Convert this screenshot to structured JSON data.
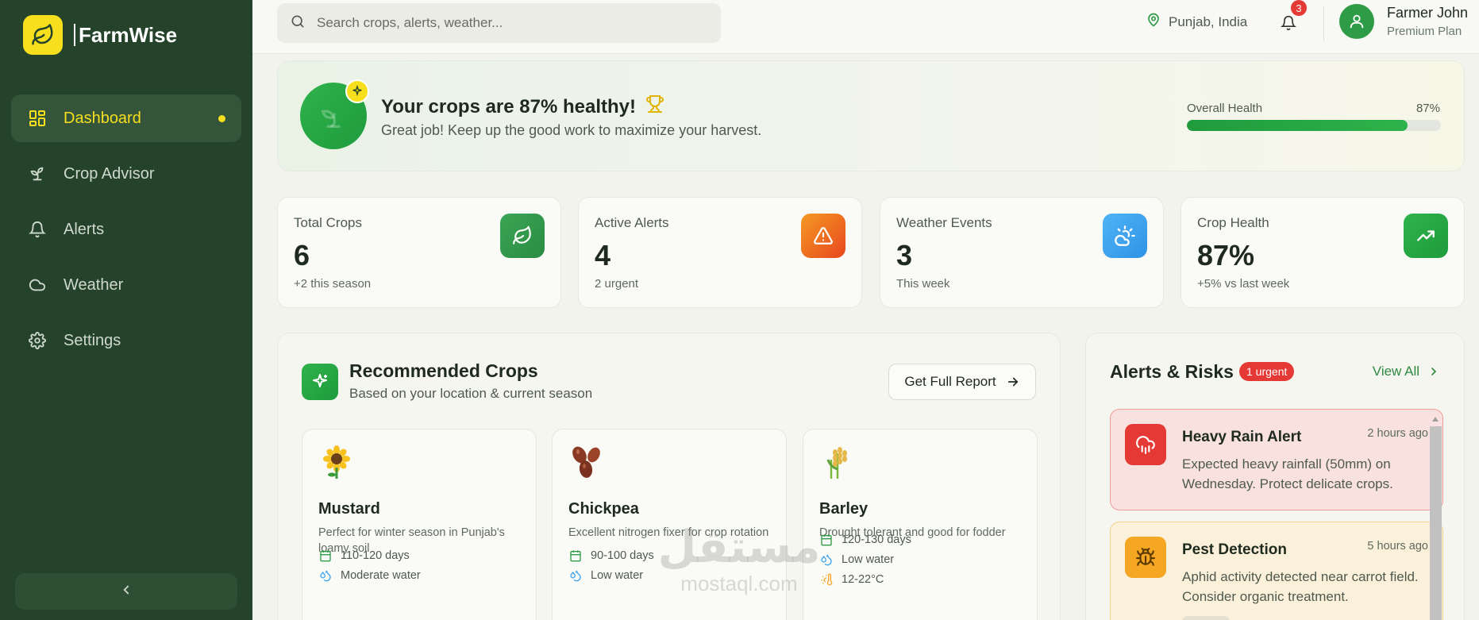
{
  "brand": {
    "name": "FarmWise"
  },
  "sidebar": {
    "items": [
      {
        "label": "Dashboard",
        "icon": "grid-icon",
        "active": true
      },
      {
        "label": "Crop Advisor",
        "icon": "sprout-icon",
        "active": false
      },
      {
        "label": "Alerts",
        "icon": "bell-icon",
        "active": false
      },
      {
        "label": "Weather",
        "icon": "cloud-icon",
        "active": false
      },
      {
        "label": "Settings",
        "icon": "gear-icon",
        "active": false
      }
    ]
  },
  "topbar": {
    "search_placeholder": "Search crops, alerts, weather...",
    "location": "Punjab, India",
    "notification_count": "3",
    "user_name": "Farmer John",
    "user_plan": "Premium Plan"
  },
  "banner": {
    "title": "Your crops are 87% healthy!",
    "subtitle": "Great job! Keep up the good work to maximize your harvest.",
    "health_label": "Overall Health",
    "health_value": "87%",
    "health_fraction": 0.87
  },
  "stats": [
    {
      "label": "Total Crops",
      "value": "6",
      "sub": "+2 this season",
      "icon": "leaf-icon",
      "color": "#2e9b47"
    },
    {
      "label": "Active Alerts",
      "value": "4",
      "sub": "2 urgent",
      "icon": "warning-icon",
      "color": "#f06a1e"
    },
    {
      "label": "Weather Events",
      "value": "3",
      "sub": "This week",
      "icon": "sun-cloud-icon",
      "color": "#3ba3f0"
    },
    {
      "label": "Crop Health",
      "value": "87%",
      "sub": "+5% vs last week",
      "icon": "trend-up-icon",
      "color": "#1f9b3c"
    }
  ],
  "recommended": {
    "title": "Recommended Crops",
    "subtitle": "Based on your location & current season",
    "button": "Get Full Report",
    "crops": [
      {
        "name": "Mustard",
        "icon": "sunflower-icon",
        "desc": "Perfect for winter season in Punjab's loamy soil",
        "duration": "110-120 days",
        "water": "Moderate water"
      },
      {
        "name": "Chickpea",
        "icon": "beans-icon",
        "desc": "Excellent nitrogen fixer for crop rotation",
        "duration": "90-100 days",
        "water": "Low water"
      },
      {
        "name": "Barley",
        "icon": "wheat-icon",
        "desc": "Drought tolerant and good for fodder",
        "duration": "120-130 days",
        "water": "Low water",
        "temp": "12-22°C"
      }
    ]
  },
  "alerts": {
    "title": "Alerts & Risks",
    "urgent_badge": "1 urgent",
    "view_all": "View All",
    "items": [
      {
        "title": "Heavy Rain Alert",
        "time": "2 hours ago",
        "body": "Expected heavy rainfall (50mm) on Wednesday. Protect delicate crops.",
        "icon": "rain-cloud-icon",
        "color": "#e53935"
      },
      {
        "title": "Pest Detection",
        "time": "5 hours ago",
        "body": "Aphid activity detected near carrot field. Consider organic treatment.",
        "icon": "bug-icon",
        "color": "#f5a623"
      }
    ]
  },
  "watermark": {
    "arabic": "مستقل",
    "latin": "mostaql.com"
  }
}
